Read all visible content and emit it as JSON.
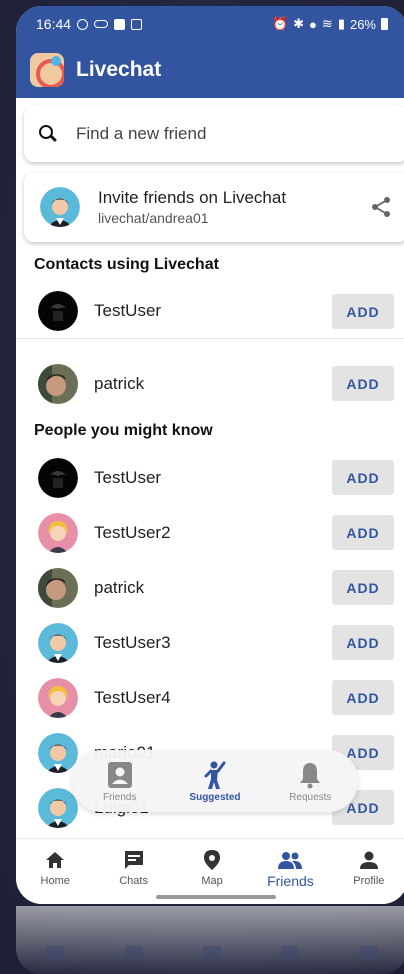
{
  "status_bar": {
    "time": "16:44",
    "battery": "26%"
  },
  "app": {
    "title": "Livechat"
  },
  "search": {
    "placeholder": "Find a new friend"
  },
  "invite": {
    "title": "Invite friends on Livechat",
    "link": "livechat/andrea01"
  },
  "sections": {
    "contacts": "Contacts using Livechat",
    "suggested": "People you might know"
  },
  "add_label": "ADD",
  "contacts": [
    {
      "name": "TestUser",
      "avatar": "dark"
    },
    {
      "name": "patrick",
      "avatar": "photo"
    }
  ],
  "people": [
    {
      "name": "TestUser",
      "avatar": "dark"
    },
    {
      "name": "TestUser2",
      "avatar": "girl"
    },
    {
      "name": "patrick",
      "avatar": "photo"
    },
    {
      "name": "TestUser3",
      "avatar": "boy"
    },
    {
      "name": "TestUser4",
      "avatar": "girl"
    },
    {
      "name": "mario01",
      "avatar": "boy"
    },
    {
      "name": "Luigi01",
      "avatar": "boy"
    }
  ],
  "friend_tabs": [
    {
      "label": "Friends",
      "icon": "contact-card-icon",
      "active": false
    },
    {
      "label": "Suggested",
      "icon": "person-waving-icon",
      "active": true
    },
    {
      "label": "Requests",
      "icon": "bell-icon",
      "active": false
    }
  ],
  "bottom_nav": [
    {
      "label": "Home",
      "icon": "home-icon",
      "active": false
    },
    {
      "label": "Chats",
      "icon": "chat-icon",
      "active": false
    },
    {
      "label": "Map",
      "icon": "map-pin-icon",
      "active": false
    },
    {
      "label": "Friends",
      "icon": "people-icon",
      "active": true
    },
    {
      "label": "Profile",
      "icon": "person-icon",
      "active": false
    }
  ],
  "colors": {
    "primary": "#3355a0",
    "add_button_bg": "#e3e3e3",
    "background": "#23263f"
  }
}
